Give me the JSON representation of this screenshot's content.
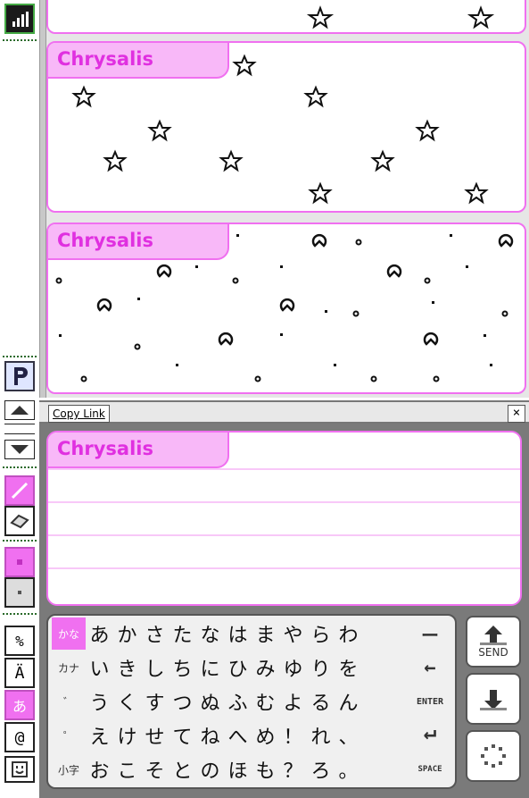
{
  "feed": {
    "messages": [
      {
        "sender": "Chrysalis",
        "doodle": "stars"
      },
      {
        "sender": "Chrysalis",
        "doodle": "bubbles"
      }
    ]
  },
  "copy_bar": {
    "copy_link_label": "Copy Link",
    "close_label": "×"
  },
  "compose": {
    "sender": "Chrysalis"
  },
  "keyboard": {
    "mode_labels": [
      "かな",
      "カナ",
      "゛",
      "゜",
      "小字"
    ],
    "rows": [
      [
        "あ",
        "か",
        "さ",
        "た",
        "な",
        "は",
        "ま",
        "や",
        "ら",
        "わ"
      ],
      [
        "い",
        "き",
        "し",
        "ち",
        "に",
        "ひ",
        "み",
        "ゆ",
        "り",
        "を"
      ],
      [
        "う",
        "く",
        "す",
        "つ",
        "ぬ",
        "ふ",
        "む",
        "よ",
        "る",
        "ん"
      ],
      [
        "え",
        "け",
        "せ",
        "て",
        "ね",
        "へ",
        "め",
        "！",
        "れ",
        "、"
      ],
      [
        "お",
        "こ",
        "そ",
        "と",
        "の",
        "ほ",
        "も",
        "？",
        "ろ",
        "。"
      ]
    ],
    "side_keys": [
      "ー",
      "←",
      "ENTER",
      "↵",
      "SPACE"
    ],
    "send_label": "SEND"
  },
  "left_toolbar": {
    "icons": [
      "signal-icon",
      "pictochat-p-icon",
      "scroll-up-icon",
      "scroll-down-icon",
      "pencil-icon",
      "eraser-icon",
      "big-pen-icon",
      "small-pen-icon",
      "latin-keyboard-icon",
      "accents-keyboard-icon",
      "kana-keyboard-icon",
      "symbols-keyboard-icon",
      "emoticon-keyboard-icon"
    ]
  },
  "colors": {
    "accent": "#f070f0",
    "accent_light": "#f8b8f8",
    "panel_gray": "#7a7a7a"
  }
}
